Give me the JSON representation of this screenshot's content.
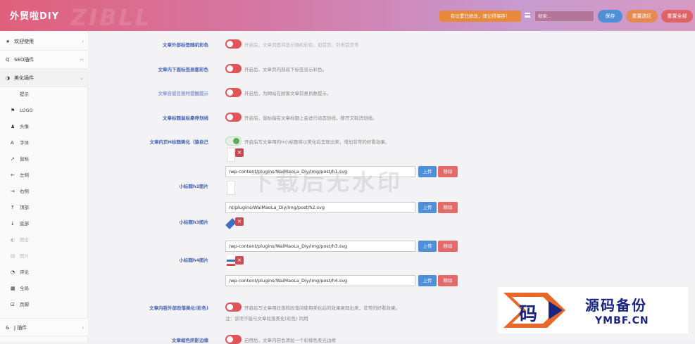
{
  "header": {
    "title": "外贸啦DIY",
    "watermark": "ZIBLL",
    "notice": "有设置已修改，请记得保存！",
    "search_placeholder": "搜索...",
    "save": "保存",
    "reset_section": "重置选区",
    "reset_all": "重置全部"
  },
  "sidebar": {
    "items": [
      {
        "icon": "★",
        "label": "欢迎使用",
        "arrow": "›"
      },
      {
        "icon": "Q",
        "label": "SEO插件",
        "arrow": "‹›"
      },
      {
        "icon": "◑",
        "label": "美化插件",
        "arrow": "⌄"
      }
    ],
    "sub_items": [
      {
        "icon": "",
        "label": "提示"
      },
      {
        "icon": "⚑",
        "label": "LOGO"
      },
      {
        "icon": "♟",
        "label": "头像"
      },
      {
        "icon": "A",
        "label": "字体"
      },
      {
        "icon": "➚",
        "label": "鼠标"
      },
      {
        "icon": "←",
        "label": "左侧"
      },
      {
        "icon": "→",
        "label": "右侧"
      },
      {
        "icon": "↑",
        "label": "顶部"
      },
      {
        "icon": "↓",
        "label": "底部"
      },
      {
        "icon": "◐",
        "label": "图层"
      },
      {
        "icon": "▤",
        "label": "图片"
      },
      {
        "icon": "◔",
        "label": "评论"
      },
      {
        "icon": "▦",
        "label": "全局"
      },
      {
        "icon": "⊡",
        "label": "页脚"
      }
    ],
    "bottom_item": {
      "icon": "&",
      "label": "J 插件",
      "arrow": "›"
    }
  },
  "settings": [
    {
      "label": "文章外部标签随机彩色",
      "desc": "开启后，文章页面将显示随机彩色，如首页，列表首页等"
    },
    {
      "label": "文章内下面标签居都彩色",
      "desc": "开启后，文章页内部底下标签显示彩色。"
    },
    {
      "label": "文章自留目居时提醒提示",
      "desc": "开启后，为网站在顾客文章前意员数提示。"
    },
    {
      "label": "文章标题鼠标悬停划线",
      "desc": "开启后，鼠标指在文章标题上会进行动态划线，移开又取消划线。"
    },
    {
      "label": "文章内页H标题美化（猿自己",
      "desc": "开启后写文章用的H小标题将以美化后呈现出来，增加非常的好看效果。"
    }
  ],
  "headings": [
    {
      "label": "",
      "path": "/wp-content/plugins/WaiMaoLa_Diy/img/post/h1.svg",
      "upload": "上传",
      "remove": "移除"
    },
    {
      "label": "小标题h2图片",
      "path": "nt/plugins/WaiMaoLa_Diy/img/post/h2.svg",
      "upload": "上传",
      "remove": "移除"
    },
    {
      "label": "小标题h3图片",
      "path": "/wp-content/plugins/WaiMaoLa_Diy/img/post/h3.svg",
      "upload": "上传",
      "remove": "移除"
    },
    {
      "label": "小标题h4图片",
      "path": "/wp-content/plugins/WaiMaoLa_Diy/img/post/h4.svg",
      "upload": "上传",
      "remove": "移除"
    }
  ],
  "bottom_settings": [
    {
      "label": "文章内容外部段落美化(彩色)",
      "desc": "开启后写文章用段落和段落间使用美化后的效果展现出来，非常的好看效果。",
      "note": "注：该项不能与文章段落美化(彩色) 同用"
    },
    {
      "label": "文章缩色阴影边缘",
      "desc": "启用后，文章内容会添加一个彩缘色柔光边框"
    }
  ],
  "overlay": {
    "watermark": "下载后无水印",
    "badge_cn": "源码备份",
    "badge_en": "YMBF.CN",
    "badge_logo": "码"
  },
  "colors": {
    "accent_blue": "#4e8fd8",
    "toggle_red": "#e0555c",
    "label_blue": "#4a67b5"
  }
}
